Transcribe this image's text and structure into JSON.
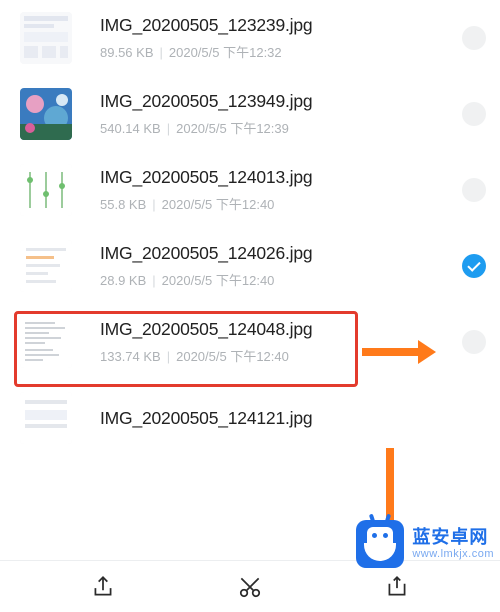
{
  "files": [
    {
      "name": "IMG_20200505_123239.jpg",
      "size": "89.56 KB",
      "date": "2020/5/5 下午12:32",
      "selected": false,
      "thumb": "ui"
    },
    {
      "name": "IMG_20200505_123949.jpg",
      "size": "540.14 KB",
      "date": "2020/5/5 下午12:39",
      "selected": false,
      "thumb": "photo"
    },
    {
      "name": "IMG_20200505_124013.jpg",
      "size": "55.8 KB",
      "date": "2020/5/5 下午12:40",
      "selected": false,
      "thumb": "chart"
    },
    {
      "name": "IMG_20200505_124026.jpg",
      "size": "28.9 KB",
      "date": "2020/5/5 下午12:40",
      "selected": true,
      "thumb": "list"
    },
    {
      "name": "IMG_20200505_124048.jpg",
      "size": "133.74 KB",
      "date": "2020/5/5 下午12:40",
      "selected": false,
      "thumb": "text"
    },
    {
      "name": "IMG_20200505_124121.jpg",
      "size": "",
      "date": "",
      "selected": false,
      "thumb": "ui"
    }
  ],
  "watermark": {
    "title": "蓝安卓网",
    "url": "www.lmkjx.com"
  },
  "highlight_row_index": 3
}
